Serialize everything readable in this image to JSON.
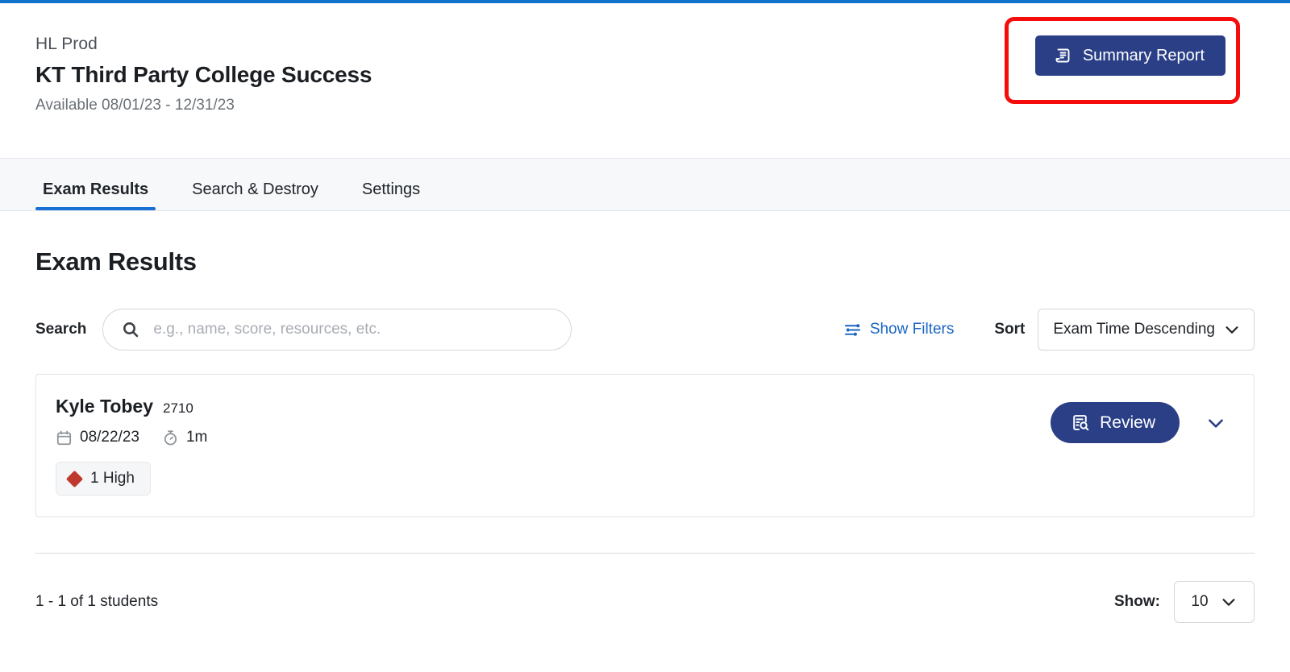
{
  "header": {
    "org_name": "HL Prod",
    "course_title": "KT Third Party College Success",
    "availability": "Available 08/01/23 - 12/31/23",
    "summary_report_label": "Summary Report",
    "summary_report_icon": "scroll-report-icon",
    "highlight_color": "#f50d0d",
    "button_color": "#2a3f86"
  },
  "tabs": [
    {
      "label": "Exam Results",
      "active": true
    },
    {
      "label": "Search & Destroy",
      "active": false
    },
    {
      "label": "Settings",
      "active": false
    }
  ],
  "main": {
    "page_heading": "Exam Results",
    "search_label": "Search",
    "search_value": "",
    "search_placeholder": "e.g., name, score, resources, etc.",
    "search_icon": "search-icon",
    "show_filters_label": "Show Filters",
    "show_filters_icon": "filter-sliders-icon",
    "show_filters_color": "#1964c2",
    "sort_label": "Sort",
    "sort_value": "Exam Time Descending"
  },
  "results": [
    {
      "student_name": "Kyle Tobey",
      "student_id": "2710",
      "date": "08/22/23",
      "date_icon": "calendar-icon",
      "duration": "1m",
      "duration_icon": "stopwatch-icon",
      "flags": [
        {
          "label": "1 High",
          "severity_icon": "red-diamond-icon",
          "color": "#c0392f"
        }
      ],
      "review_label": "Review",
      "review_icon": "document-search-icon",
      "expand_icon": "chevron-down-icon"
    }
  ],
  "footer": {
    "count_text": "1 - 1 of 1 students",
    "show_label": "Show:",
    "show_value": "10",
    "show_chevron_icon": "chevron-down-icon"
  }
}
